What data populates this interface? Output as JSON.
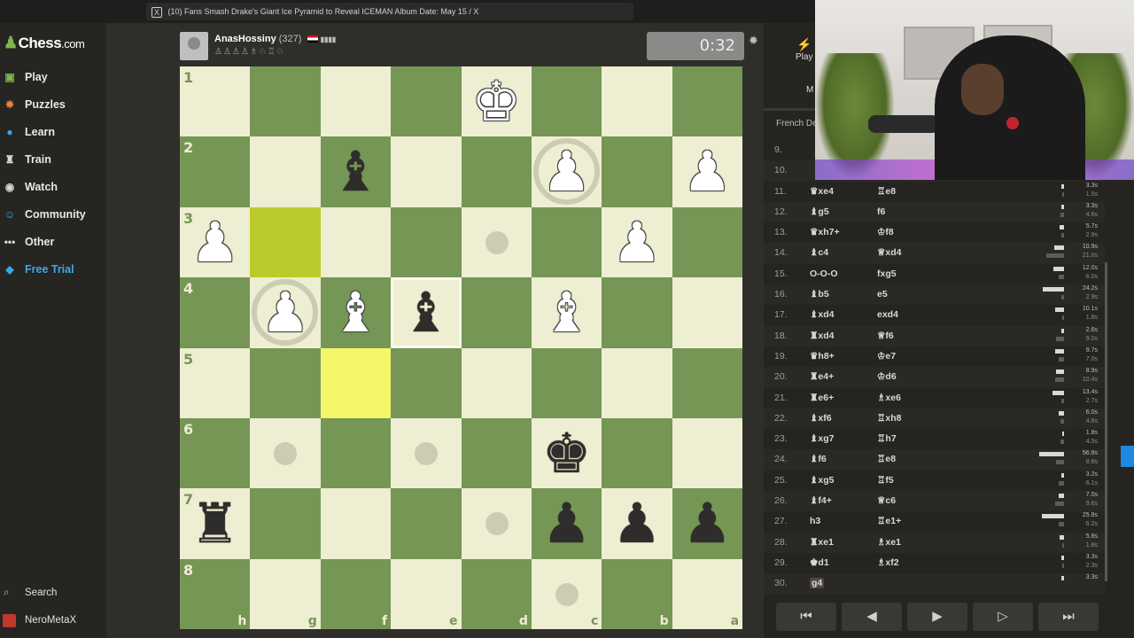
{
  "browser": {
    "tab_title": "(10) Fans Smash Drake's Giant Ice Pyramid to Reveal ICEMAN Album Date: May 15 / X",
    "tab_icon": "X"
  },
  "sidebar": {
    "logo_main": "Chess",
    "logo_suffix": ".com",
    "items": [
      {
        "label": "Play",
        "icon": "play-icon",
        "glyph": "▣",
        "color": "#81b64c"
      },
      {
        "label": "Puzzles",
        "icon": "puzzle-icon",
        "glyph": "✸",
        "color": "#f0803c"
      },
      {
        "label": "Learn",
        "icon": "learn-icon",
        "glyph": "●",
        "color": "#3aa8e8"
      },
      {
        "label": "Train",
        "icon": "train-icon",
        "glyph": "♜",
        "color": "#d8d8d8"
      },
      {
        "label": "Watch",
        "icon": "watch-icon",
        "glyph": "◉",
        "color": "#d8d8d8"
      },
      {
        "label": "Community",
        "icon": "community-icon",
        "glyph": "☺",
        "color": "#3aa8e8"
      },
      {
        "label": "Other",
        "icon": "more-icon",
        "glyph": "•••",
        "color": "#d8d8d8"
      },
      {
        "label": "Free Trial",
        "icon": "diamond-icon",
        "glyph": "◆",
        "color": "#3aa8e8"
      }
    ],
    "search_label": "Search",
    "user_label": "NeroMetaX"
  },
  "player": {
    "name": "AnasHossiny",
    "rating": "(327)",
    "signal": "▮▮▮▮",
    "captured": "♙♙♙♙♗♘♖♘",
    "clock": "0:32"
  },
  "board": {
    "ranks": [
      "1",
      "2",
      "3",
      "4",
      "5",
      "6",
      "7",
      "8"
    ],
    "files": [
      "h",
      "g",
      "f",
      "e",
      "d",
      "c",
      "b",
      "a"
    ],
    "highlights": [
      "2-1",
      "4-2"
    ],
    "hover": "3-3",
    "pieces": [
      {
        "sq": "0-4",
        "glyph": "♚",
        "color": "white"
      },
      {
        "sq": "1-2",
        "glyph": "♝",
        "color": "black"
      },
      {
        "sq": "1-5",
        "glyph": "♟",
        "color": "white"
      },
      {
        "sq": "1-7",
        "glyph": "♟",
        "color": "white"
      },
      {
        "sq": "2-0",
        "glyph": "♟",
        "color": "white"
      },
      {
        "sq": "2-6",
        "glyph": "♟",
        "color": "white"
      },
      {
        "sq": "3-1",
        "glyph": "♟",
        "color": "white"
      },
      {
        "sq": "3-2",
        "glyph": "♝",
        "color": "white"
      },
      {
        "sq": "3-3",
        "glyph": "♝",
        "color": "black"
      },
      {
        "sq": "3-5",
        "glyph": "♝",
        "color": "white"
      },
      {
        "sq": "5-5",
        "glyph": "♚",
        "color": "black"
      },
      {
        "sq": "6-0",
        "glyph": "♜",
        "color": "black"
      },
      {
        "sq": "6-5",
        "glyph": "♟",
        "color": "black"
      },
      {
        "sq": "6-6",
        "glyph": "♟",
        "color": "black"
      },
      {
        "sq": "6-7",
        "glyph": "♟",
        "color": "black"
      }
    ],
    "dots": [
      "2-4",
      "5-1",
      "5-3",
      "6-4",
      "7-5"
    ],
    "rings": [
      "1-5",
      "3-1"
    ]
  },
  "panel": {
    "tab_label": "Play",
    "tab2_label": "M",
    "opening": "French De",
    "moves": [
      {
        "n": "9.",
        "w": "",
        "b": "",
        "tw": "",
        "tb": "",
        "ww": 0,
        "wb": 0
      },
      {
        "n": "10.",
        "w": "",
        "b": "",
        "tw": "",
        "tb": "",
        "ww": 0,
        "wb": 0
      },
      {
        "n": "11.",
        "w": "♛xe4",
        "b": "♖e8",
        "tw": "3.3s",
        "tb": "1.5s",
        "ww": 3,
        "wb": 2
      },
      {
        "n": "12.",
        "w": "♝g5",
        "b": "f6",
        "tw": "3.3s",
        "tb": "4.6s",
        "ww": 3,
        "wb": 4
      },
      {
        "n": "13.",
        "w": "♛xh7+",
        "b": "♔f8",
        "tw": "5.7s",
        "tb": "2.9s",
        "ww": 5,
        "wb": 3
      },
      {
        "n": "14.",
        "w": "♝c4",
        "b": "♕xd4",
        "tw": "10.9s",
        "tb": "21.0s",
        "ww": 10,
        "wb": 19
      },
      {
        "n": "15.",
        "w": "O-O-O",
        "b": "fxg5",
        "tw": "12.0s",
        "tb": "6.0s",
        "ww": 11,
        "wb": 6
      },
      {
        "n": "16.",
        "w": "♝b5",
        "b": "e5",
        "tw": "24.2s",
        "tb": "2.9s",
        "ww": 22,
        "wb": 3
      },
      {
        "n": "17.",
        "w": "♝xd4",
        "b": "exd4",
        "tw": "10.1s",
        "tb": "1.8s",
        "ww": 9,
        "wb": 2
      },
      {
        "n": "18.",
        "w": "♜xd4",
        "b": "♕f6",
        "tw": "2.6s",
        "tb": "9.0s",
        "ww": 3,
        "wb": 8
      },
      {
        "n": "19.",
        "w": "♛h8+",
        "b": "♔e7",
        "tw": "9.7s",
        "tb": "7.0s",
        "ww": 9,
        "wb": 6
      },
      {
        "n": "20.",
        "w": "♜e4+",
        "b": "♔d6",
        "tw": "8.9s",
        "tb": "10.4s",
        "ww": 8,
        "wb": 9
      },
      {
        "n": "21.",
        "w": "♜e6+",
        "b": "♗xe6",
        "tw": "13.4s",
        "tb": "2.7s",
        "ww": 12,
        "wb": 3
      },
      {
        "n": "22.",
        "w": "♝xf6",
        "b": "♖xh8",
        "tw": "6.0s",
        "tb": "4.6s",
        "ww": 6,
        "wb": 4
      },
      {
        "n": "23.",
        "w": "♝xg7",
        "b": "♖h7",
        "tw": "1.8s",
        "tb": "4.5s",
        "ww": 2,
        "wb": 4
      },
      {
        "n": "24.",
        "w": "♝f6",
        "b": "♖e8",
        "tw": "56.8s",
        "tb": "8.8s",
        "ww": 26,
        "wb": 8
      },
      {
        "n": "25.",
        "w": "♝xg5",
        "b": "♖f5",
        "tw": "3.2s",
        "tb": "6.1s",
        "ww": 3,
        "wb": 6
      },
      {
        "n": "26.",
        "w": "♝f4+",
        "b": "♕c6",
        "tw": "7.0s",
        "tb": "9.6s",
        "ww": 6,
        "wb": 9
      },
      {
        "n": "27.",
        "w": "h3",
        "b": "♖e1+",
        "tw": "25.8s",
        "tb": "6.2s",
        "ww": 23,
        "wb": 6
      },
      {
        "n": "28.",
        "w": "♜xe1",
        "b": "♗xe1",
        "tw": "5.8s",
        "tb": "1.8s",
        "ww": 5,
        "wb": 2
      },
      {
        "n": "29.",
        "w": "♚d1",
        "b": "♗xf2",
        "tw": "3.3s",
        "tb": "2.3s",
        "ww": 3,
        "wb": 2
      },
      {
        "n": "30.",
        "w": "g4",
        "b": "",
        "tw": "3.3s",
        "tb": "",
        "ww": 3,
        "wb": 0
      }
    ],
    "controls": [
      "⏮",
      "◀",
      "▶",
      "▷",
      "⏭"
    ]
  }
}
